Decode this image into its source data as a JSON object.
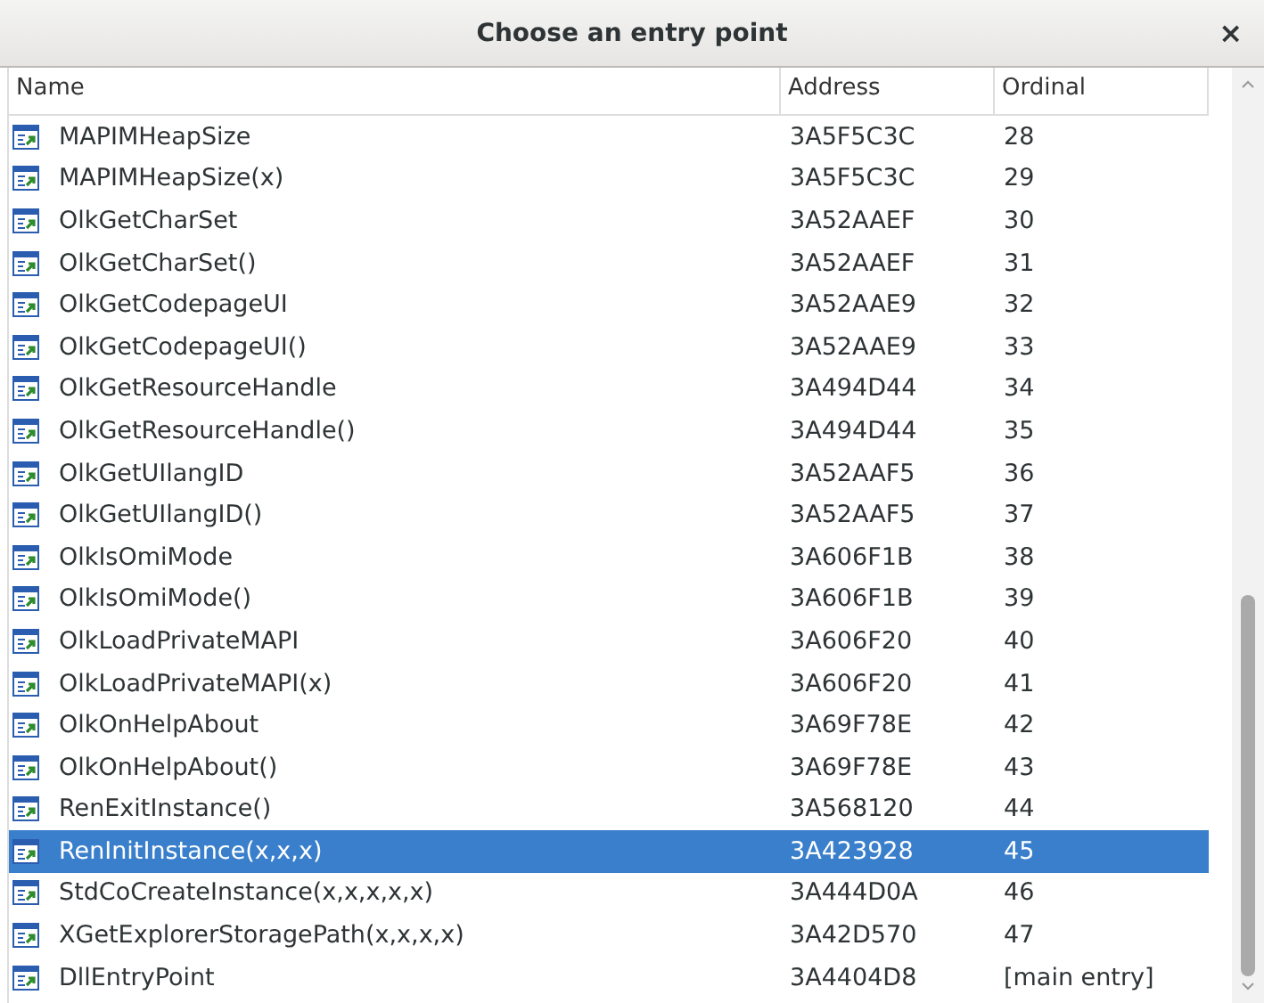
{
  "window": {
    "title": "Choose an entry point",
    "close": "×"
  },
  "table": {
    "columns": [
      "Name",
      "Address",
      "Ordinal"
    ],
    "rows": [
      {
        "name": "MAPIMHeapSize",
        "address": "3A5F5C3C",
        "ordinal": "28",
        "selected": false
      },
      {
        "name": "MAPIMHeapSize(x)",
        "address": "3A5F5C3C",
        "ordinal": "29",
        "selected": false
      },
      {
        "name": "OlkGetCharSet",
        "address": "3A52AAEF",
        "ordinal": "30",
        "selected": false
      },
      {
        "name": "OlkGetCharSet()",
        "address": "3A52AAEF",
        "ordinal": "31",
        "selected": false
      },
      {
        "name": "OlkGetCodepageUI",
        "address": "3A52AAE9",
        "ordinal": "32",
        "selected": false
      },
      {
        "name": "OlkGetCodepageUI()",
        "address": "3A52AAE9",
        "ordinal": "33",
        "selected": false
      },
      {
        "name": "OlkGetResourceHandle",
        "address": "3A494D44",
        "ordinal": "34",
        "selected": false
      },
      {
        "name": "OlkGetResourceHandle()",
        "address": "3A494D44",
        "ordinal": "35",
        "selected": false
      },
      {
        "name": "OlkGetUIlangID",
        "address": "3A52AAF5",
        "ordinal": "36",
        "selected": false
      },
      {
        "name": "OlkGetUIlangID()",
        "address": "3A52AAF5",
        "ordinal": "37",
        "selected": false
      },
      {
        "name": "OlkIsOmiMode",
        "address": "3A606F1B",
        "ordinal": "38",
        "selected": false
      },
      {
        "name": "OlkIsOmiMode()",
        "address": "3A606F1B",
        "ordinal": "39",
        "selected": false
      },
      {
        "name": "OlkLoadPrivateMAPI",
        "address": "3A606F20",
        "ordinal": "40",
        "selected": false
      },
      {
        "name": "OlkLoadPrivateMAPI(x)",
        "address": "3A606F20",
        "ordinal": "41",
        "selected": false
      },
      {
        "name": "OlkOnHelpAbout",
        "address": "3A69F78E",
        "ordinal": "42",
        "selected": false
      },
      {
        "name": "OlkOnHelpAbout()",
        "address": "3A69F78E",
        "ordinal": "43",
        "selected": false
      },
      {
        "name": "RenExitInstance()",
        "address": "3A568120",
        "ordinal": "44",
        "selected": false
      },
      {
        "name": "RenInitInstance(x,x,x)",
        "address": "3A423928",
        "ordinal": "45",
        "selected": true
      },
      {
        "name": "StdCoCreateInstance(x,x,x,x,x)",
        "address": "3A444D0A",
        "ordinal": "46",
        "selected": false
      },
      {
        "name": "XGetExplorerStoragePath(x,x,x,x)",
        "address": "3A42D570",
        "ordinal": "47",
        "selected": false
      },
      {
        "name": "DllEntryPoint",
        "address": "3A4404D8",
        "ordinal": "[main entry]",
        "selected": false
      }
    ]
  }
}
